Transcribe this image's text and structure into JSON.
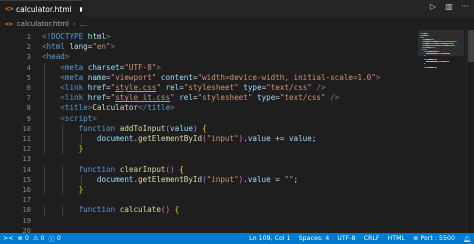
{
  "tab": {
    "label": "calculator.html",
    "modified": true
  },
  "breadcrumb": {
    "label": "calculator.html",
    "chevron": "›",
    "next": "..."
  },
  "tab_actions": {
    "run": "▷",
    "split": "▥",
    "more": "···"
  },
  "editor": {
    "lines": [
      {
        "n": "1",
        "indent": 0,
        "tokens": [
          [
            "punct",
            "<!"
          ],
          [
            "tag",
            "DOCTYPE"
          ],
          [
            "text",
            " "
          ],
          [
            "attr",
            "html"
          ],
          [
            "punct",
            ">"
          ]
        ]
      },
      {
        "n": "2",
        "indent": 0,
        "tokens": [
          [
            "punct",
            "<"
          ],
          [
            "tag",
            "html"
          ],
          [
            "text",
            " "
          ],
          [
            "attr",
            "lang"
          ],
          [
            "text",
            "="
          ],
          [
            "str",
            "\"en\""
          ],
          [
            "punct",
            ">"
          ]
        ]
      },
      {
        "n": "3",
        "indent": 0,
        "tokens": [
          [
            "punct",
            "<"
          ],
          [
            "tag",
            "head"
          ],
          [
            "punct",
            ">"
          ]
        ]
      },
      {
        "n": "4",
        "indent": 1,
        "tokens": [
          [
            "punct",
            "<"
          ],
          [
            "tag",
            "meta"
          ],
          [
            "text",
            " "
          ],
          [
            "attr",
            "charset"
          ],
          [
            "text",
            "="
          ],
          [
            "str",
            "\"UTF-8\""
          ],
          [
            "punct",
            ">"
          ]
        ]
      },
      {
        "n": "5",
        "indent": 1,
        "tokens": [
          [
            "punct",
            "<"
          ],
          [
            "tag",
            "meta"
          ],
          [
            "text",
            " "
          ],
          [
            "attr",
            "name"
          ],
          [
            "text",
            "="
          ],
          [
            "str",
            "\"viewport\""
          ],
          [
            "text",
            " "
          ],
          [
            "attr",
            "content"
          ],
          [
            "text",
            "="
          ],
          [
            "str",
            "\"width=device-width, initial-scale=1.0\""
          ],
          [
            "punct",
            ">"
          ]
        ]
      },
      {
        "n": "6",
        "indent": 1,
        "tokens": [
          [
            "punct",
            "<"
          ],
          [
            "tag",
            "link"
          ],
          [
            "text",
            " "
          ],
          [
            "attr",
            "href"
          ],
          [
            "text",
            "="
          ],
          [
            "str",
            "\""
          ],
          [
            "link",
            "style.css"
          ],
          [
            "str",
            "\""
          ],
          [
            "text",
            " "
          ],
          [
            "attr",
            "rel"
          ],
          [
            "text",
            "="
          ],
          [
            "str",
            "\"stylesheet\""
          ],
          [
            "text",
            " "
          ],
          [
            "attr",
            "type"
          ],
          [
            "text",
            "="
          ],
          [
            "str",
            "\"text/css\""
          ],
          [
            "text",
            " "
          ],
          [
            "punct",
            "/>"
          ]
        ]
      },
      {
        "n": "7",
        "indent": 1,
        "tokens": [
          [
            "punct",
            "<"
          ],
          [
            "tag",
            "link"
          ],
          [
            "text",
            " "
          ],
          [
            "attr",
            "href"
          ],
          [
            "text",
            "="
          ],
          [
            "str",
            "\""
          ],
          [
            "link",
            "style_it.css"
          ],
          [
            "str",
            "\""
          ],
          [
            "text",
            " "
          ],
          [
            "attr",
            "rel"
          ],
          [
            "text",
            "="
          ],
          [
            "str",
            "\"stylesheet\""
          ],
          [
            "text",
            " "
          ],
          [
            "attr",
            "type"
          ],
          [
            "text",
            "="
          ],
          [
            "str",
            "\"text/css\""
          ],
          [
            "text",
            " "
          ],
          [
            "punct",
            "/>"
          ]
        ]
      },
      {
        "n": "8",
        "indent": 1,
        "tokens": [
          [
            "punct",
            "<"
          ],
          [
            "tag",
            "title"
          ],
          [
            "punct",
            ">"
          ],
          [
            "text",
            "Calculator"
          ],
          [
            "punct",
            "</"
          ],
          [
            "tag",
            "title"
          ],
          [
            "punct",
            ">"
          ]
        ]
      },
      {
        "n": "9",
        "indent": 1,
        "tokens": [
          [
            "punct",
            "<"
          ],
          [
            "tag",
            "script"
          ],
          [
            "punct",
            ">"
          ]
        ]
      },
      {
        "n": "10",
        "indent": 2,
        "tokens": [
          [
            "kw",
            "function"
          ],
          [
            "text",
            " "
          ],
          [
            "fn",
            "addToInput"
          ],
          [
            "paren",
            "("
          ],
          [
            "var",
            "value"
          ],
          [
            "paren",
            ")"
          ],
          [
            "text",
            " "
          ],
          [
            "brace",
            "{"
          ]
        ]
      },
      {
        "n": "11",
        "indent": 3,
        "tokens": [
          [
            "var",
            "document"
          ],
          [
            "text",
            "."
          ],
          [
            "fn",
            "getElementById"
          ],
          [
            "paren",
            "("
          ],
          [
            "str",
            "\"input\""
          ],
          [
            "paren",
            ")"
          ],
          [
            "text",
            "."
          ],
          [
            "var",
            "value"
          ],
          [
            "text",
            " += "
          ],
          [
            "var",
            "value"
          ],
          [
            "text",
            ";"
          ]
        ]
      },
      {
        "n": "12",
        "indent": 2,
        "tokens": [
          [
            "brace",
            "}"
          ]
        ]
      },
      {
        "n": "13",
        "indent": 0,
        "tokens": []
      },
      {
        "n": "14",
        "indent": 2,
        "tokens": [
          [
            "kw",
            "function"
          ],
          [
            "text",
            " "
          ],
          [
            "fn",
            "clearInput"
          ],
          [
            "paren",
            "("
          ],
          [
            "paren",
            ")"
          ],
          [
            "text",
            " "
          ],
          [
            "brace",
            "{"
          ]
        ]
      },
      {
        "n": "15",
        "indent": 3,
        "tokens": [
          [
            "var",
            "document"
          ],
          [
            "text",
            "."
          ],
          [
            "fn",
            "getElementById"
          ],
          [
            "paren",
            "("
          ],
          [
            "str",
            "\"input\""
          ],
          [
            "paren",
            ")"
          ],
          [
            "text",
            "."
          ],
          [
            "var",
            "value"
          ],
          [
            "text",
            " = "
          ],
          [
            "str",
            "\"\""
          ],
          [
            "text",
            ";"
          ]
        ]
      },
      {
        "n": "16",
        "indent": 2,
        "tokens": [
          [
            "brace",
            "}"
          ]
        ]
      },
      {
        "n": "17",
        "indent": 0,
        "tokens": []
      },
      {
        "n": "18",
        "indent": 2,
        "tokens": [
          [
            "kw",
            "function"
          ],
          [
            "text",
            " "
          ],
          [
            "fn",
            "calculate"
          ],
          [
            "paren",
            "("
          ],
          [
            "paren",
            ")"
          ],
          [
            "text",
            " "
          ],
          [
            "brace",
            "{"
          ]
        ]
      },
      {
        "n": "19",
        "indent": 0,
        "tokens": []
      },
      {
        "n": "20",
        "indent": 0,
        "tokens": []
      }
    ]
  },
  "statusbar": {
    "remote": "><",
    "errors": "0",
    "warnings": "0",
    "info": "0",
    "position": "Ln 109, Col 1",
    "spaces": "Spaces: 4",
    "encoding": "UTF-8",
    "eol": "CRLF",
    "language": "HTML",
    "port": "Port : 5500",
    "notifications_icon": "bell-icon"
  },
  "colors": {
    "statusbar": "#007acc",
    "editor_bg": "#1e1e1e",
    "tag": "#569cd6",
    "attr": "#9cdcfe",
    "string": "#ce9178",
    "function": "#dcdcaa"
  }
}
